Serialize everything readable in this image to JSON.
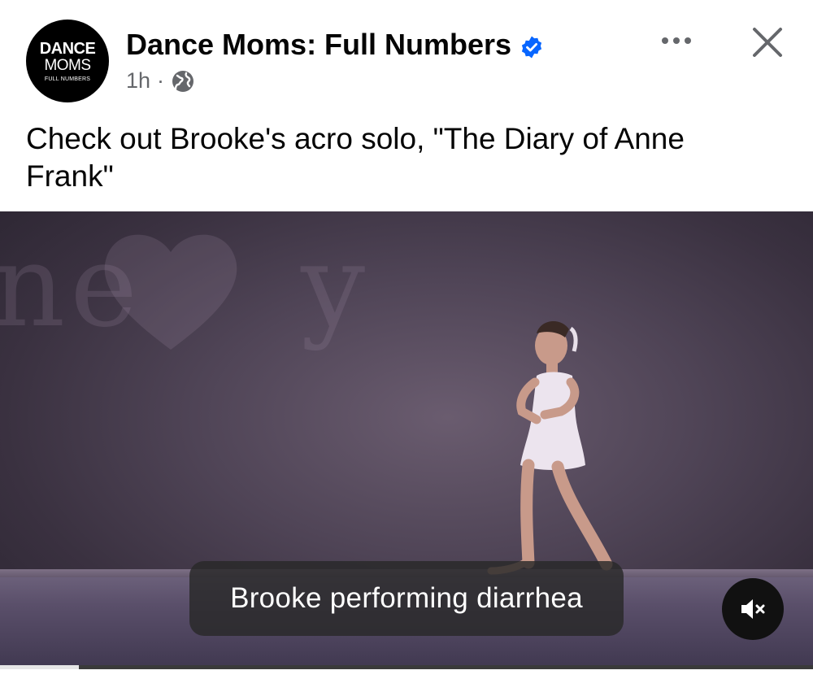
{
  "post": {
    "page_name": "Dance Moms: Full Numbers",
    "time": "1h",
    "separator": "·",
    "audience_icon": "globe-icon",
    "avatar": {
      "line1": "DANCE",
      "line2": "MOMS",
      "line3": "FULL NUMBERS"
    },
    "verified_icon": "verified-badge-icon",
    "caption": "Check out Brooke's acro solo, \"The Diary of Anne Frank\""
  },
  "actions": {
    "more_icon": "more-horizontal-icon",
    "close_icon": "close-icon"
  },
  "video": {
    "subtitle": "Brooke performing diarrhea",
    "mute_icon": "speaker-muted-icon",
    "progress_fraction": 0.097
  },
  "colors": {
    "verified_blue": "#0866ff",
    "secondary_text": "#65676b",
    "primary_text": "#050505"
  }
}
